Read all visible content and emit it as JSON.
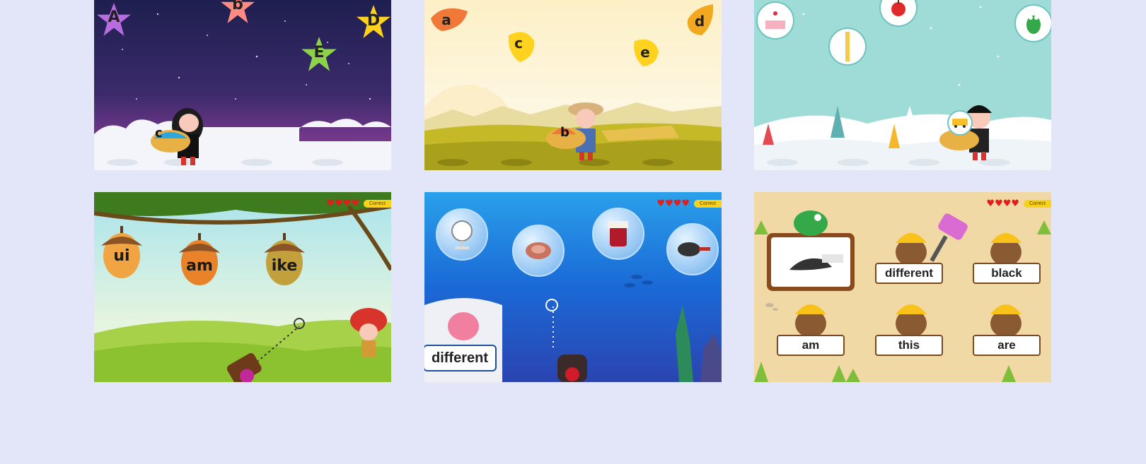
{
  "tiles": {
    "night_stars": {
      "stars": [
        {
          "letter": "A",
          "color": "#b96ce0"
        },
        {
          "letter": "b",
          "color": "#ff8a82"
        },
        {
          "letter": "D",
          "color": "#ffd21f"
        },
        {
          "letter": "E",
          "color": "#8ed14a"
        }
      ],
      "basket_letter": "c"
    },
    "autumn_leaves": {
      "leaves": [
        {
          "letter": "a",
          "color": "#f07838"
        },
        {
          "letter": "c",
          "color": "#ffd21f"
        },
        {
          "letter": "d",
          "color": "#f2a91f"
        },
        {
          "letter": "e",
          "color": "#ffd21f"
        }
      ],
      "basket_letter": "b"
    },
    "snow_bubbles": {
      "items": [
        "cake-icon",
        "apple-icon",
        "ruler-icon",
        "crocodile-icon",
        "bus-icon"
      ]
    },
    "acorn_shooter": {
      "acorns": [
        "ui",
        "am",
        "ike"
      ],
      "hearts": "♥♥♥♥",
      "badge": "Correct"
    },
    "underwater_bubbles": {
      "bubbles": [
        "fan-icon",
        "ham-icon",
        "jam-jar-icon",
        "frying-pan-icon"
      ],
      "word": "different",
      "hearts": "♥♥♥♥",
      "badge": "Correct"
    },
    "whack_a_mole": {
      "words": [
        "different",
        "black",
        "am",
        "this",
        "are"
      ],
      "hearts": "♥♥♥♥",
      "badge": "Correct"
    }
  }
}
